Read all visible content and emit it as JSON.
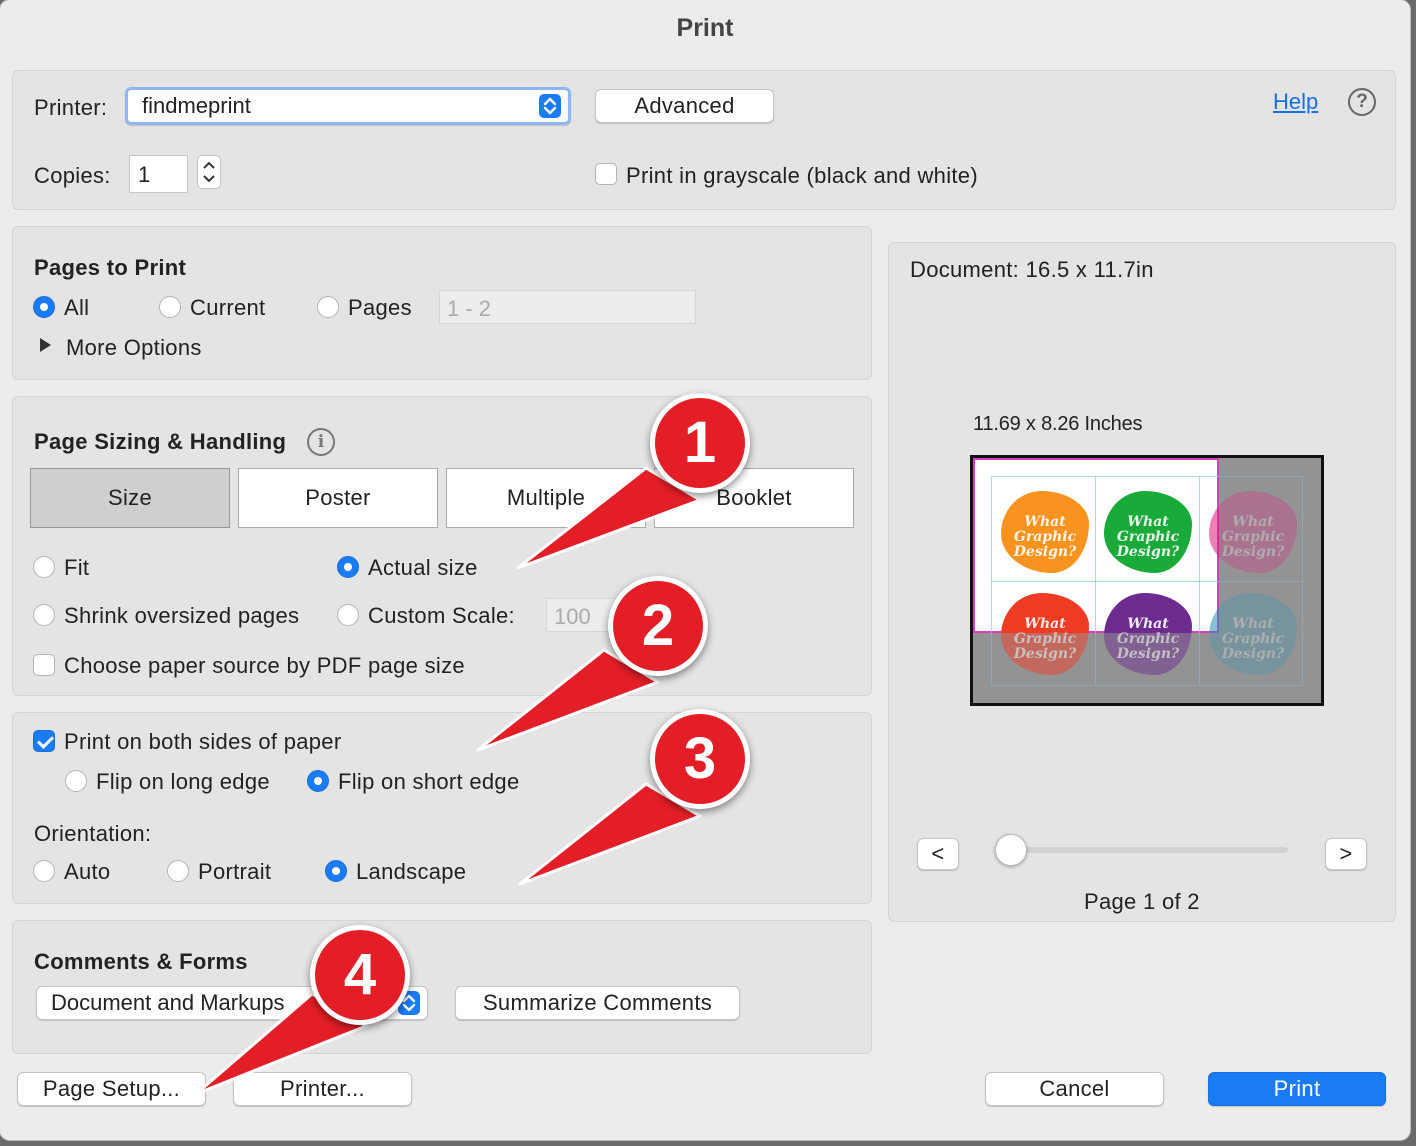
{
  "dialog": {
    "title": "Print"
  },
  "printer": {
    "label": "Printer:",
    "value": "findmeprint",
    "advanced": "Advanced",
    "help": "Help",
    "help_icon": "?"
  },
  "copies": {
    "label": "Copies:",
    "value": "1",
    "grayscale": "Print in grayscale (black and white)"
  },
  "pages_to_print": {
    "title": "Pages to Print",
    "all": "All",
    "current": "Current",
    "pages": "Pages",
    "pages_value": "1 - 2",
    "more_options": "More Options"
  },
  "sizing": {
    "title": "Page Sizing & Handling",
    "info_icon": "i",
    "tabs": [
      "Size",
      "Poster",
      "Multiple",
      "Booklet"
    ],
    "fit": "Fit",
    "actual_size": "Actual size",
    "shrink": "Shrink oversized pages",
    "custom_scale": "Custom Scale:",
    "scale_value": "100",
    "paper_source": "Choose paper source by PDF page size"
  },
  "duplex": {
    "both_sides": "Print on both sides of paper",
    "flip_long": "Flip on long edge",
    "flip_short": "Flip on short edge",
    "orientation_label": "Orientation:",
    "auto": "Auto",
    "portrait": "Portrait",
    "landscape": "Landscape"
  },
  "comments": {
    "title": "Comments & Forms",
    "value": "Document and Markups",
    "summarize": "Summarize Comments"
  },
  "preview": {
    "document_size": "Document: 16.5 x 11.7in",
    "paper_size": "11.69 x 8.26 Inches",
    "prev": "<",
    "next": ">",
    "page_label": "Page 1 of 2",
    "slider_position": 0,
    "blob_text": "What Graphic Design?"
  },
  "footer": {
    "page_setup": "Page Setup...",
    "printer": "Printer...",
    "cancel": "Cancel",
    "print": "Print"
  },
  "annotations": [
    "1",
    "2",
    "3",
    "4"
  ],
  "colors": {
    "accent": "#1a7cf5",
    "annotation_red": "#e31e26",
    "blob_orange": "#f7931e",
    "blob_green": "#1aaa3a",
    "blob_magenta": "#e3197e",
    "blob_red": "#ee3b24",
    "blob_purple": "#6d2a8f",
    "blob_blue": "#2a92b8"
  }
}
